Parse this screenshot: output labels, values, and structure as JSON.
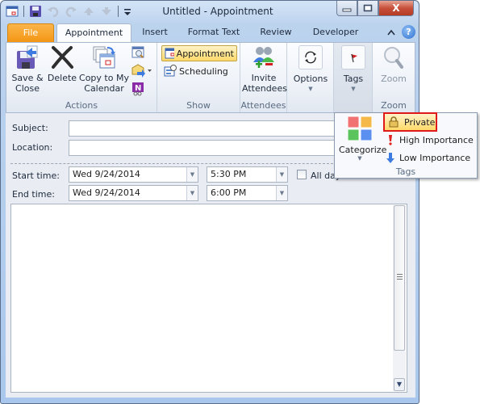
{
  "window": {
    "title": "Untitled  -  Appointment",
    "controls": {
      "minimize": "—",
      "maximize": "□",
      "close": "X"
    }
  },
  "quick_access": {
    "icons": [
      "calendar-icon",
      "save-icon",
      "undo-icon",
      "redo-icon",
      "up-arrow-icon",
      "down-arrow-icon",
      "customize-qat-icon"
    ]
  },
  "tabs": [
    {
      "label": "File"
    },
    {
      "label": "Appointment",
      "active": true
    },
    {
      "label": "Insert"
    },
    {
      "label": "Format Text"
    },
    {
      "label": "Review"
    },
    {
      "label": "Developer"
    }
  ],
  "help": {
    "collapse_glyph": "^",
    "help_glyph": "?"
  },
  "ribbon": {
    "actions": {
      "label": "Actions",
      "save_close_line1": "Save &",
      "save_close_line2": "Close",
      "delete": "Delete",
      "copy_line1": "Copy to My",
      "copy_line2": "Calendar"
    },
    "show": {
      "label": "Show",
      "appointment": "Appointment",
      "scheduling": "Scheduling"
    },
    "attendees": {
      "label": "Attendees",
      "invite_line1": "Invite",
      "invite_line2": "Attendees"
    },
    "options": {
      "label": "Options"
    },
    "tags": {
      "label": "Tags"
    },
    "zoom": {
      "button": "Zoom",
      "label": "Zoom"
    }
  },
  "tags_popup": {
    "categorize": "Categorize",
    "private": "Private",
    "high_importance": "High Importance",
    "low_importance": "Low Importance",
    "group_label": "Tags",
    "category_colors": [
      "#f07272",
      "#f5b94a",
      "#5cc45c",
      "#5b8ff0"
    ]
  },
  "form": {
    "subject_label": "Subject:",
    "subject_value": "",
    "location_label": "Location:",
    "location_value": "",
    "start_label": "Start time:",
    "start_date": "Wed 9/24/2014",
    "start_time": "5:30 PM",
    "end_label": "End time:",
    "end_date": "Wed 9/24/2014",
    "end_time": "6:00 PM",
    "all_day_label": "All day",
    "all_day_checked": false
  },
  "colors": {
    "file_tab": "#f39512",
    "highlight": "#ffd969",
    "private_outline": "#e01a1a"
  }
}
